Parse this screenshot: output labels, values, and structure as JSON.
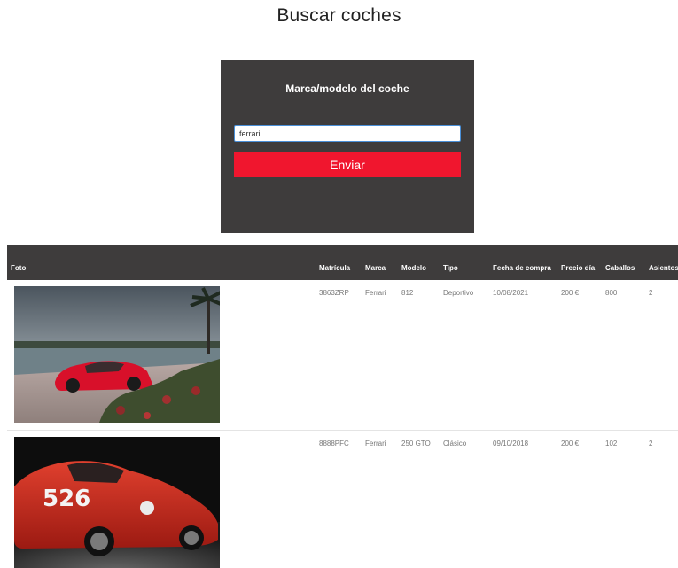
{
  "page": {
    "title": "Buscar coches"
  },
  "search": {
    "label": "Marca/modelo del coche",
    "value": "ferrari",
    "submit_label": "Enviar"
  },
  "table": {
    "headers": {
      "foto": "Foto",
      "matricula": "Matrícula",
      "marca": "Marca",
      "modelo": "Modelo",
      "tipo": "Tipo",
      "fecha": "Fecha de compra",
      "precio": "Precio día",
      "caballos": "Caballos",
      "asientos": "Asientos"
    },
    "rows": [
      {
        "matricula": "3863ZRP",
        "marca": "Ferrari",
        "modelo": "812",
        "tipo": "Deportivo",
        "fecha": "10/08/2021",
        "precio": "200 €",
        "caballos": "800",
        "asientos": "2"
      },
      {
        "matricula": "8888PFC",
        "marca": "Ferrari",
        "modelo": "250 GTO",
        "tipo": "Clásico",
        "fecha": "09/10/2018",
        "precio": "200 €",
        "caballos": "102",
        "asientos": "2",
        "race_number": "526"
      }
    ]
  },
  "colors": {
    "header_bg": "#3e3c3c",
    "accent_red": "#f0162e",
    "input_focus": "#4a90d9"
  }
}
